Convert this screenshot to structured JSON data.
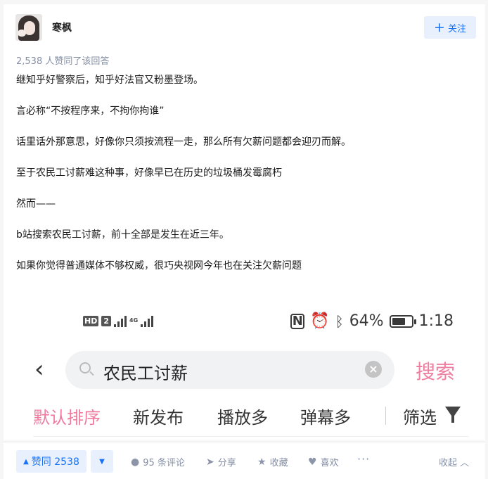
{
  "author": {
    "name": "寒枫"
  },
  "follow": {
    "label": "关注",
    "icon": "plus-icon"
  },
  "upvote_info": "2,538 人赞同了该回答",
  "paragraphs": [
    "继知乎好警察后，知乎好法官又粉墨登场。",
    "言必称“不按程序来，不拘你拘谁”",
    "话里话外那意思，好像你只须按流程一走，那么所有欠薪问题都会迎刃而解。",
    "至于农民工讨薪难这种事，好像早已在历史的垃圾桶发霉腐朽",
    "然而——",
    "b站搜索农民工讨薪，前十全部是发生在近三年。",
    "如果你觉得普通媒体不够权威，很巧央视网今年也在关注欠薪问题"
  ],
  "screenshot": {
    "status": {
      "hd": "HD",
      "sim": "2",
      "net": "4G",
      "battery": "64%",
      "time": "1:18"
    },
    "search_query": "农民工讨薪",
    "search_button": "搜索",
    "filters": [
      "默认排序",
      "新发布",
      "播放多",
      "弹幕多",
      "筛选"
    ]
  },
  "actions": {
    "vote_label": "赞同 2538",
    "comments": "95 条评论",
    "share": "分享",
    "favorite": "收藏",
    "like": "喜欢",
    "more": "···",
    "collapse": "收起"
  },
  "colors": {
    "accent": "#1772f6",
    "accent_bg": "#e8f0fe",
    "bilibili_pink": "#f07aa0",
    "muted": "#8590a6"
  }
}
